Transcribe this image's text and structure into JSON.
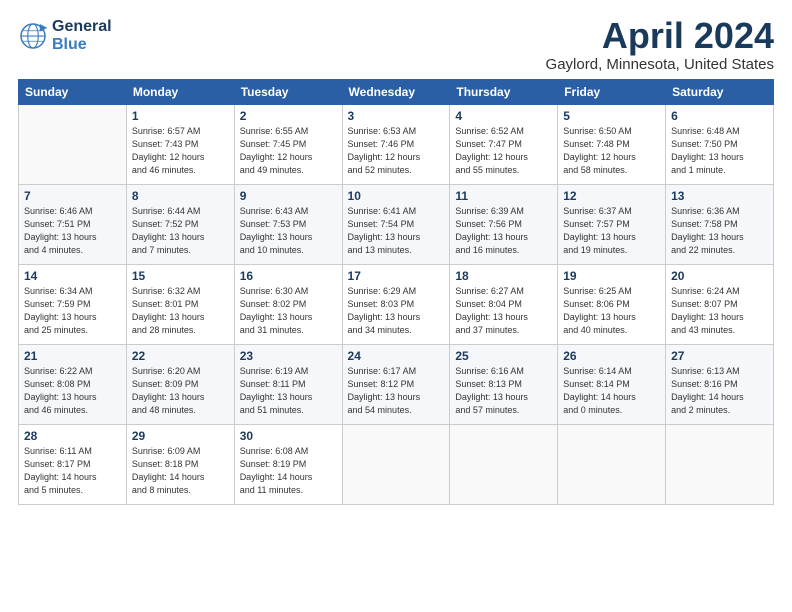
{
  "header": {
    "logo_line1": "General",
    "logo_line2": "Blue",
    "month": "April 2024",
    "location": "Gaylord, Minnesota, United States"
  },
  "weekdays": [
    "Sunday",
    "Monday",
    "Tuesday",
    "Wednesday",
    "Thursday",
    "Friday",
    "Saturday"
  ],
  "weeks": [
    [
      {
        "day": "",
        "info": ""
      },
      {
        "day": "1",
        "info": "Sunrise: 6:57 AM\nSunset: 7:43 PM\nDaylight: 12 hours\nand 46 minutes."
      },
      {
        "day": "2",
        "info": "Sunrise: 6:55 AM\nSunset: 7:45 PM\nDaylight: 12 hours\nand 49 minutes."
      },
      {
        "day": "3",
        "info": "Sunrise: 6:53 AM\nSunset: 7:46 PM\nDaylight: 12 hours\nand 52 minutes."
      },
      {
        "day": "4",
        "info": "Sunrise: 6:52 AM\nSunset: 7:47 PM\nDaylight: 12 hours\nand 55 minutes."
      },
      {
        "day": "5",
        "info": "Sunrise: 6:50 AM\nSunset: 7:48 PM\nDaylight: 12 hours\nand 58 minutes."
      },
      {
        "day": "6",
        "info": "Sunrise: 6:48 AM\nSunset: 7:50 PM\nDaylight: 13 hours\nand 1 minute."
      }
    ],
    [
      {
        "day": "7",
        "info": "Sunrise: 6:46 AM\nSunset: 7:51 PM\nDaylight: 13 hours\nand 4 minutes."
      },
      {
        "day": "8",
        "info": "Sunrise: 6:44 AM\nSunset: 7:52 PM\nDaylight: 13 hours\nand 7 minutes."
      },
      {
        "day": "9",
        "info": "Sunrise: 6:43 AM\nSunset: 7:53 PM\nDaylight: 13 hours\nand 10 minutes."
      },
      {
        "day": "10",
        "info": "Sunrise: 6:41 AM\nSunset: 7:54 PM\nDaylight: 13 hours\nand 13 minutes."
      },
      {
        "day": "11",
        "info": "Sunrise: 6:39 AM\nSunset: 7:56 PM\nDaylight: 13 hours\nand 16 minutes."
      },
      {
        "day": "12",
        "info": "Sunrise: 6:37 AM\nSunset: 7:57 PM\nDaylight: 13 hours\nand 19 minutes."
      },
      {
        "day": "13",
        "info": "Sunrise: 6:36 AM\nSunset: 7:58 PM\nDaylight: 13 hours\nand 22 minutes."
      }
    ],
    [
      {
        "day": "14",
        "info": "Sunrise: 6:34 AM\nSunset: 7:59 PM\nDaylight: 13 hours\nand 25 minutes."
      },
      {
        "day": "15",
        "info": "Sunrise: 6:32 AM\nSunset: 8:01 PM\nDaylight: 13 hours\nand 28 minutes."
      },
      {
        "day": "16",
        "info": "Sunrise: 6:30 AM\nSunset: 8:02 PM\nDaylight: 13 hours\nand 31 minutes."
      },
      {
        "day": "17",
        "info": "Sunrise: 6:29 AM\nSunset: 8:03 PM\nDaylight: 13 hours\nand 34 minutes."
      },
      {
        "day": "18",
        "info": "Sunrise: 6:27 AM\nSunset: 8:04 PM\nDaylight: 13 hours\nand 37 minutes."
      },
      {
        "day": "19",
        "info": "Sunrise: 6:25 AM\nSunset: 8:06 PM\nDaylight: 13 hours\nand 40 minutes."
      },
      {
        "day": "20",
        "info": "Sunrise: 6:24 AM\nSunset: 8:07 PM\nDaylight: 13 hours\nand 43 minutes."
      }
    ],
    [
      {
        "day": "21",
        "info": "Sunrise: 6:22 AM\nSunset: 8:08 PM\nDaylight: 13 hours\nand 46 minutes."
      },
      {
        "day": "22",
        "info": "Sunrise: 6:20 AM\nSunset: 8:09 PM\nDaylight: 13 hours\nand 48 minutes."
      },
      {
        "day": "23",
        "info": "Sunrise: 6:19 AM\nSunset: 8:11 PM\nDaylight: 13 hours\nand 51 minutes."
      },
      {
        "day": "24",
        "info": "Sunrise: 6:17 AM\nSunset: 8:12 PM\nDaylight: 13 hours\nand 54 minutes."
      },
      {
        "day": "25",
        "info": "Sunrise: 6:16 AM\nSunset: 8:13 PM\nDaylight: 13 hours\nand 57 minutes."
      },
      {
        "day": "26",
        "info": "Sunrise: 6:14 AM\nSunset: 8:14 PM\nDaylight: 14 hours\nand 0 minutes."
      },
      {
        "day": "27",
        "info": "Sunrise: 6:13 AM\nSunset: 8:16 PM\nDaylight: 14 hours\nand 2 minutes."
      }
    ],
    [
      {
        "day": "28",
        "info": "Sunrise: 6:11 AM\nSunset: 8:17 PM\nDaylight: 14 hours\nand 5 minutes."
      },
      {
        "day": "29",
        "info": "Sunrise: 6:09 AM\nSunset: 8:18 PM\nDaylight: 14 hours\nand 8 minutes."
      },
      {
        "day": "30",
        "info": "Sunrise: 6:08 AM\nSunset: 8:19 PM\nDaylight: 14 hours\nand 11 minutes."
      },
      {
        "day": "",
        "info": ""
      },
      {
        "day": "",
        "info": ""
      },
      {
        "day": "",
        "info": ""
      },
      {
        "day": "",
        "info": ""
      }
    ]
  ]
}
